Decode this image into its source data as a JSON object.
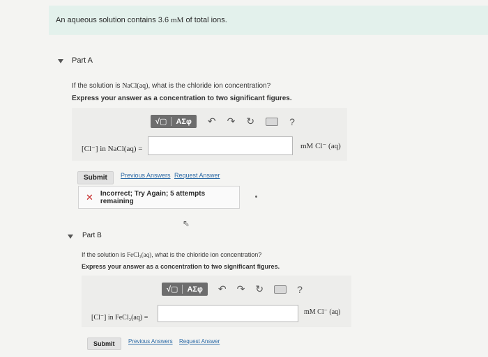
{
  "banner": {
    "text_prefix": "An aqueous solution contains 3.6",
    "unit": "mM",
    "text_suffix": "of total ions."
  },
  "partA": {
    "title": "Part A",
    "question_prefix": "If the solution is",
    "compound": "NaCl(aq)",
    "question_suffix": ", what is the chloride ion concentration?",
    "instruction": "Express your answer as a concentration to two significant figures.",
    "toolbar": {
      "root_symbol": "√▢",
      "greek": "ΑΣφ",
      "undo": "↶",
      "redo": "↷",
      "reset": "↻",
      "help": "?"
    },
    "equation_label": "[Cl⁻] in NaCl(aq) =",
    "input_value": "",
    "units": "mM Cl⁻ (aq)",
    "submit": "Submit",
    "previous_answers": "Previous Answers",
    "request_answer": "Request Answer",
    "feedback": "Incorrect; Try Again; 5 attempts remaining"
  },
  "partB": {
    "title": "Part B",
    "question_prefix": "If the solution is",
    "compound": "FeCl₃(aq)",
    "question_suffix": ", what is the chloride ion concentration?",
    "instruction": "Express your answer as a concentration to two significant figures.",
    "toolbar": {
      "root_symbol": "√▢",
      "greek": "ΑΣφ",
      "undo": "↶",
      "redo": "↷",
      "reset": "↻",
      "help": "?"
    },
    "equation_label": "[Cl⁻] in FeCl₃(aq) =",
    "input_value": "",
    "units": "mM Cl⁻ (aq)",
    "submit": "Submit",
    "previous_answers": "Previous Answers",
    "request_answer": "Request Answer"
  },
  "colors": {
    "banner_bg": "#e3f1ec",
    "link": "#2c6aa6",
    "error": "#c62828",
    "toolbar_btn": "#6d6d6d"
  }
}
